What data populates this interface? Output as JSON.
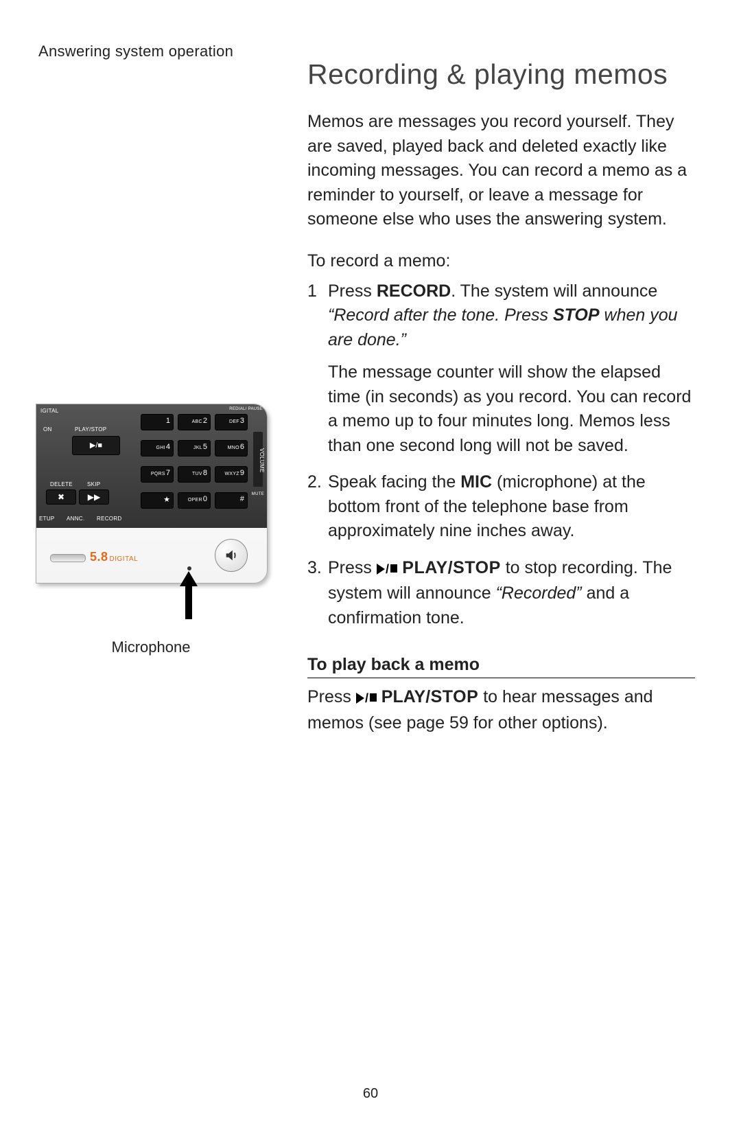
{
  "runningHead": "Answering system operation",
  "title": "Recording & playing memos",
  "intro": "Memos are messages you record yourself. They are saved, played back and deleted exactly like incoming messages. You can record a memo as a reminder to yourself, or leave a message for someone else who uses the answering system.",
  "recordHeading": "To record a memo:",
  "step1_lead": "Press ",
  "step1_record": "RECORD",
  "step1_tail": ". The system will announce ",
  "step1_quote_a": "“Record after the tone. Press ",
  "step1_quote_stop": "STOP",
  "step1_quote_b": " when you are done.”",
  "step1_para2": "The message counter will show the elapsed time (in seconds) as you record. You can record a memo up to four minutes long. Memos less than one second long will not be saved.",
  "step2_a": "Speak facing the ",
  "step2_mic": "MIC",
  "step2_b": " (microphone) at the bottom front of the telephone base from approximately nine inches away.",
  "step3_a": "Press ",
  "step3_playstop": " PLAY/STOP",
  "step3_b": " to stop recording. The system will announce ",
  "step3_recorded": "“Recorded”",
  "step3_c": " and a confirmation tone.",
  "playbackHeading": "To play back a memo",
  "playback_a": "Press ",
  "playback_play": " PLAY",
  "playback_stop": "/STOP",
  "playback_b": " to hear messages and memos (see page 59 for other options).",
  "pageNumber": "60",
  "figure": {
    "micLabel": "Microphone",
    "brand": "5.8",
    "brandSub": "DIGITAL",
    "labels": {
      "redial": "REDIAL/ PAUSE",
      "on": "ON",
      "playstop": "PLAY/STOP",
      "delete": "DELETE",
      "skip": "SKIP",
      "setup": "ETUP",
      "annc": "ANNC.",
      "record": "RECORD",
      "volume": "VOLUME",
      "mute": "MUTE",
      "digital": "IGITAL"
    },
    "keys": {
      "k1": {
        "pre": "",
        "d": "1"
      },
      "k2": {
        "pre": "ABC",
        "d": "2"
      },
      "k3": {
        "pre": "DEF",
        "d": "3"
      },
      "k4": {
        "pre": "GHI",
        "d": "4"
      },
      "k5": {
        "pre": "JKL",
        "d": "5"
      },
      "k6": {
        "pre": "MNO",
        "d": "6"
      },
      "k7": {
        "pre": "PQRS",
        "d": "7"
      },
      "k8": {
        "pre": "TUV",
        "d": "8"
      },
      "k9": {
        "pre": "WXYZ",
        "d": "9"
      },
      "kstar": {
        "pre": "",
        "d": "★"
      },
      "k0": {
        "pre": "OPER",
        "d": "0"
      },
      "khash": {
        "pre": "",
        "d": "#"
      }
    }
  }
}
